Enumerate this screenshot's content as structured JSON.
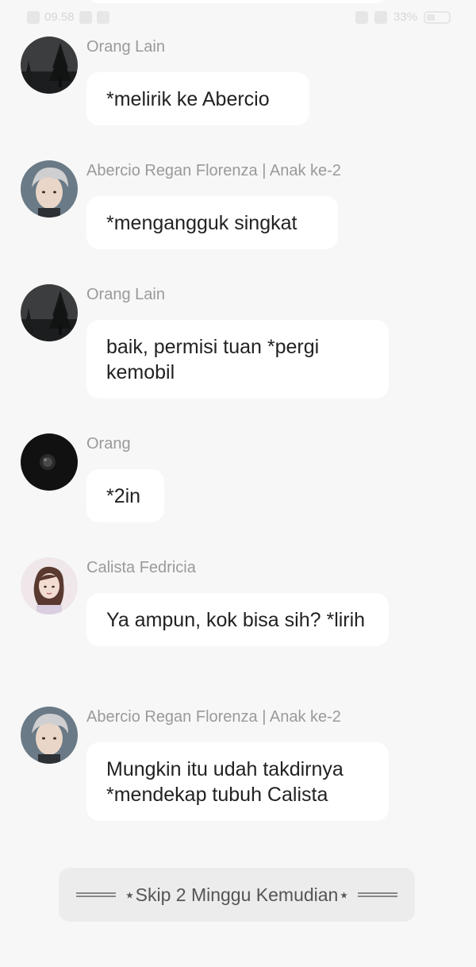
{
  "status_bar": {
    "time": "09.58",
    "battery": "33%"
  },
  "messages": [
    {
      "sender": "Orang Lain",
      "text": "*melirik ke Abercio",
      "avatar": "forest-night-avatar"
    },
    {
      "sender": "Abercio Regan Florenza | Anak ke-2",
      "text": "*mengangguk singkat",
      "avatar": "silver-hair-man-avatar"
    },
    {
      "sender": "Orang Lain",
      "text": "baik, permisi tuan *pergi kemobil",
      "avatar": "forest-night-avatar"
    },
    {
      "sender": "Orang",
      "text": "*2in",
      "avatar": "dark-orb-avatar"
    },
    {
      "sender": "Calista Fedricia",
      "text": "Ya ampun, kok bisa sih? *lirih",
      "avatar": "woman-avatar"
    },
    {
      "sender": "Abercio Regan Florenza | Anak ke-2",
      "text": "Mungkin itu udah takdirnya *mendekap tubuh Calista",
      "avatar": "silver-hair-man-avatar"
    }
  ],
  "skip_banner": {
    "text": "⋆Skip 2 Minggu Kemudian⋆"
  }
}
